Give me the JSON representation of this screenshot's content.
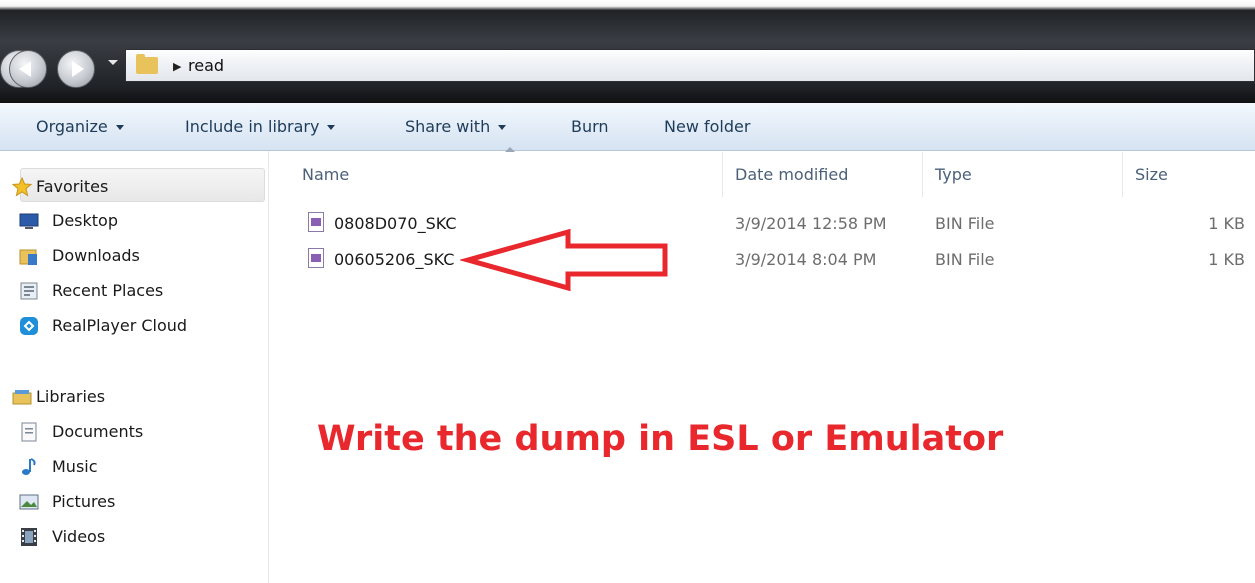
{
  "address": {
    "path": "read"
  },
  "toolbar": {
    "organize": "Organize",
    "include": "Include in library",
    "share": "Share with",
    "burn": "Burn",
    "new_folder": "New folder"
  },
  "nav": {
    "favorites_label": "Favorites",
    "favorites": [
      {
        "label": "Desktop",
        "icon": "desktop-icon"
      },
      {
        "label": "Downloads",
        "icon": "downloads-icon"
      },
      {
        "label": "Recent Places",
        "icon": "recent-places-icon"
      },
      {
        "label": "RealPlayer Cloud",
        "icon": "realplayer-cloud-icon"
      }
    ],
    "libraries_label": "Libraries",
    "libraries": [
      {
        "label": "Documents",
        "icon": "documents-icon"
      },
      {
        "label": "Music",
        "icon": "music-icon"
      },
      {
        "label": "Pictures",
        "icon": "pictures-icon"
      },
      {
        "label": "Videos",
        "icon": "videos-icon"
      }
    ]
  },
  "columns": {
    "name": "Name",
    "date": "Date modified",
    "type": "Type",
    "size": "Size"
  },
  "files": [
    {
      "name": "0808D070_SKC",
      "date": "3/9/2014 12:58 PM",
      "type": "BIN File",
      "size": "1 KB"
    },
    {
      "name": "00605206_SKC",
      "date": "3/9/2014 8:04 PM",
      "type": "BIN File",
      "size": "1 KB"
    }
  ],
  "annotation": {
    "text": "Write the dump in ESL or Emulator",
    "color": "#e8282d"
  },
  "colors": {
    "toolbar_text": "#1e3c5a",
    "column_header": "#4c607a",
    "selected_background": "#ececec"
  }
}
